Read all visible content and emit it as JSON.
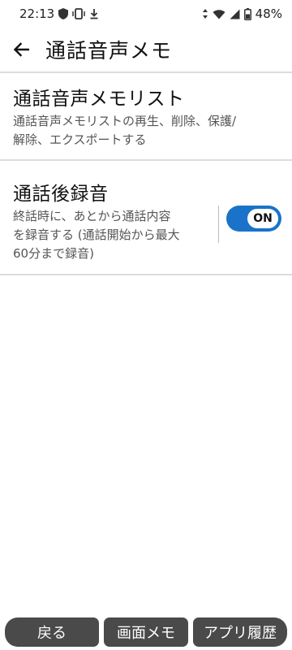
{
  "status_bar": {
    "time": "22:13",
    "battery": "48%",
    "icons": [
      "shield-icon",
      "vibrate-icon",
      "download-icon",
      "data-arrows-icon",
      "wifi-icon",
      "signal-icon",
      "battery-icon"
    ]
  },
  "app_bar": {
    "back_icon": "arrow-left-icon",
    "title": "通話音声メモ"
  },
  "settings": [
    {
      "title": "通話音声メモリスト",
      "description_lines": [
        "通話音声メモリストの再生、削除、保護/",
        "解除、エクスポートする"
      ]
    },
    {
      "title": "通話後録音",
      "description_lines": [
        "終話時に、あとから通話内容",
        "を録音する (通話開始から最大",
        "60分まで録音)"
      ],
      "toggle": {
        "state": "ON",
        "color": "#1a73c9"
      }
    }
  ],
  "nav_bar": {
    "back": "戻る",
    "screen_memo": "画面メモ",
    "app_history": "アプリ履歴"
  }
}
